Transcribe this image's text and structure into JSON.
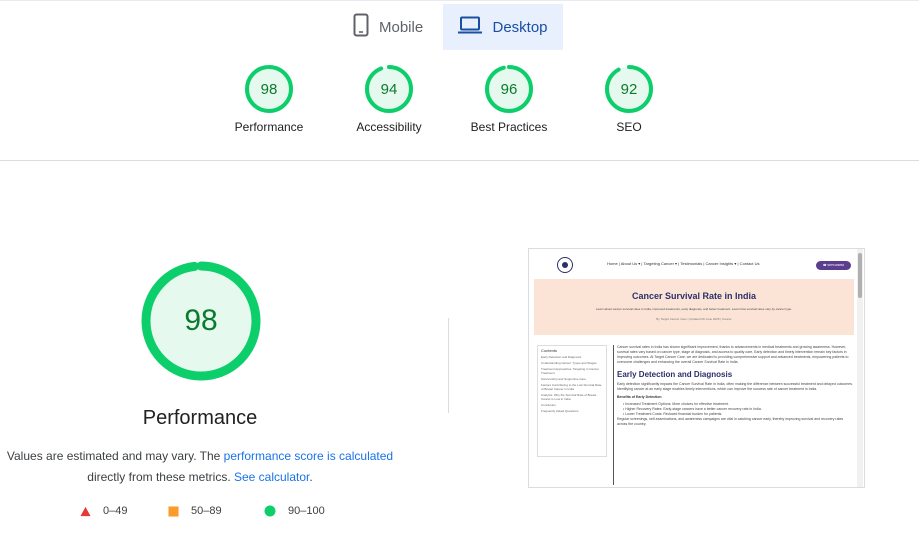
{
  "tabs": {
    "mobile": {
      "label": "Mobile"
    },
    "desktop": {
      "label": "Desktop"
    }
  },
  "scores": [
    {
      "value": "98",
      "label": "Performance",
      "fraction": 0.98
    },
    {
      "value": "94",
      "label": "Accessibility",
      "fraction": 0.94
    },
    {
      "value": "96",
      "label": "Best Practices",
      "fraction": 0.96
    },
    {
      "value": "92",
      "label": "SEO",
      "fraction": 0.92
    }
  ],
  "main": {
    "score": "98",
    "fraction": 0.98,
    "title": "Performance",
    "note_prefix": "Values are estimated and may vary. The ",
    "note_link1": "performance score is calculated",
    "note_mid": "directly from these metrics. ",
    "note_link2": "See calculator",
    "note_suffix": "."
  },
  "legend": [
    {
      "range": "0–49",
      "color": "#e53935"
    },
    {
      "range": "50–89",
      "color": "#fb9c2a"
    },
    {
      "range": "90–100",
      "color": "#0cce6b"
    }
  ],
  "colors": {
    "pass": "#0cce6b",
    "pass_text": "#0b7a2e",
    "pass_bg": "#e6f9ee",
    "link": "#1a73e8",
    "tab_active_bg": "#e8f0fe"
  },
  "thumbnail": {
    "menu": "Home  |  About Us  ▾  |  Targeting Cancer  ▾  |  Testimonials  |  Cancer Insights  ▾  |  Contact Us",
    "button": "☎ 9875439866",
    "hero_title": "Cancer Survival Rate in India",
    "hero_sub": "Learn about cancer survival rates in India, improved treatments, early diagnosis, and better treatment. Learn how survival rates vary by cancer type.",
    "hero_meta": "By Target Cancer Care  |  Updated 09 June 2025  |  Cancer",
    "toc_heading": "Contents",
    "toc_items": [
      "Early Detection and Diagnosis",
      "Understanding Cancer: Types and Stages",
      "Treatment Approaches: Targeting in Cancer Treatment",
      "Survivorship and Supportive Care",
      "Factors Contributing to the Low Survival Rate of Breast Cancer in India",
      "Analysis: Why the Survival Rate of Breast Cancer is Low in India",
      "Conclusion",
      "Frequently Asked Questions"
    ],
    "intro": "Cancer survival rates in India has shown significant improvement, thanks to advancements in medical treatments and growing awareness. However, survival rates vary based on cancer type, stage at diagnosis, and access to quality care. Early detection and timely intervention remain key factors in improving outcomes. At Target Cancer Care, we are dedicated to providing comprehensive support and advanced treatments, empowering patients to overcome challenges and enhancing the overall Cancer Survival Rate in India.",
    "h2": "Early Detection and Diagnosis",
    "p2": "Early detection significantly impacts the Cancer Survival Rate in India, often making the difference between successful treatment and delayed outcomes. Identifying cancer at an early stage enables timely interventions, which can improve the success rate of cancer treatment in India.",
    "h4": "Benefits of Early Detection",
    "bullets": [
      "• Increased Treatment Options: More choices for effective treatment.",
      "• Higher Recovery Rates: Early-stage cancers have a better cancer recovery rate in India.",
      "• Lower Treatment Costs: Reduced financial burden for patients."
    ],
    "p3": "Regular screenings, self-examinations, and awareness campaigns are vital in catching cancer early, thereby improving survival and recovery rates across the country."
  }
}
